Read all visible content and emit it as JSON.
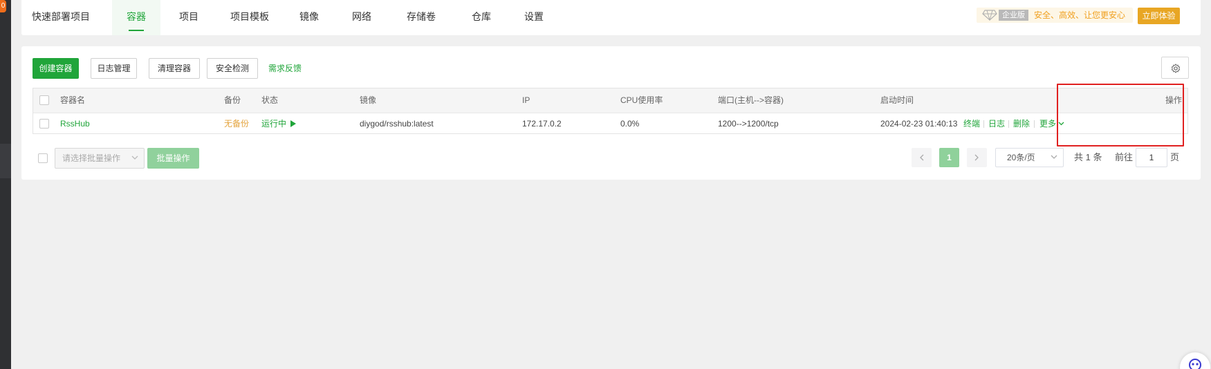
{
  "nav": {
    "tabs": [
      "快速部署项目",
      "容器",
      "项目",
      "项目模板",
      "镜像",
      "网络",
      "存储卷",
      "仓库",
      "设置"
    ],
    "active_tab": "容器",
    "promo": {
      "edition": "企业版",
      "slogan": "安全、高效、让您更安心",
      "cta": "立即体验"
    }
  },
  "toolbar": {
    "create": "创建容器",
    "logs": "日志管理",
    "clean": "清理容器",
    "security": "安全检测",
    "feedback": "需求反馈"
  },
  "table": {
    "headers": {
      "name": "容器名",
      "backup": "备份",
      "status": "状态",
      "image": "镜像",
      "ip": "IP",
      "cpu": "CPU使用率",
      "ports": "端口(主机-->容器)",
      "started": "启动时间",
      "actions": "操作"
    },
    "rows": [
      {
        "name": "RssHub",
        "backup": "无备份",
        "status": "运行中",
        "image": "diygod/rsshub:latest",
        "ip": "172.17.0.2",
        "cpu": "0.0%",
        "ports": "1200-->1200/tcp",
        "started": "2024-02-23 01:40:13",
        "actions": {
          "terminal": "终端",
          "log": "日志",
          "delete": "删除",
          "more": "更多"
        }
      }
    ]
  },
  "footer": {
    "bulk_placeholder": "请选择批量操作",
    "bulk_button": "批量操作",
    "current_page": "1",
    "page_size": "20条/页",
    "total": "共 1 条",
    "goto_label": "前往",
    "goto_value": "1",
    "page_unit": "页"
  },
  "colors": {
    "accent": "#20a53a",
    "warning": "#e4a33d",
    "highlight": "#e02020",
    "promo": "#e8a624"
  }
}
